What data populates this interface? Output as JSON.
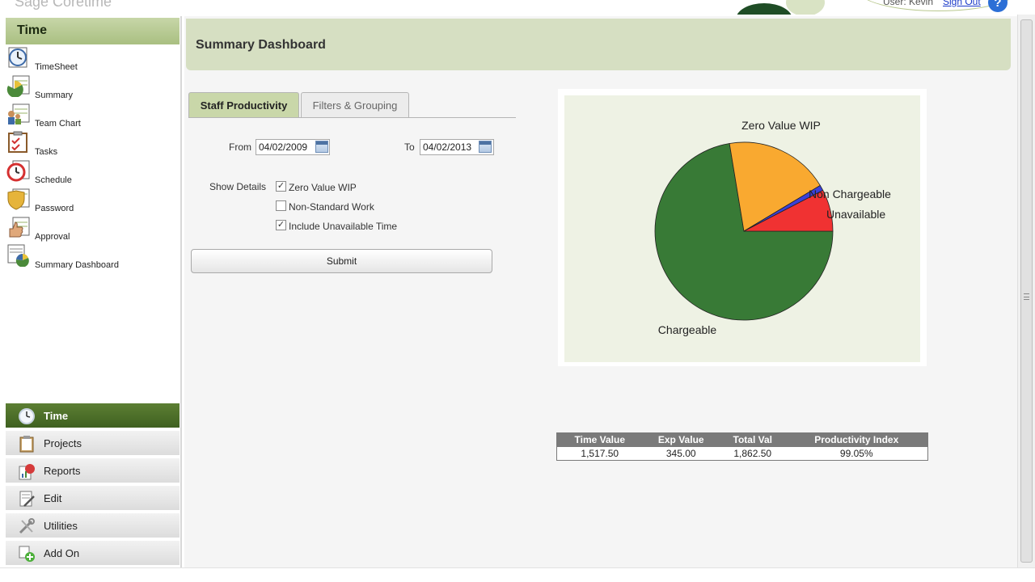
{
  "app": {
    "title": "Sage Coretime",
    "user_label": "User: Kevin",
    "sign_out": "Sign Out",
    "help": "?"
  },
  "sidebar": {
    "header": "Time",
    "items": [
      {
        "label": "TimeSheet",
        "icon": "timesheet-icon"
      },
      {
        "label": "Summary",
        "icon": "summary-icon"
      },
      {
        "label": "Team Chart",
        "icon": "team-chart-icon"
      },
      {
        "label": "Tasks",
        "icon": "tasks-icon"
      },
      {
        "label": "Schedule",
        "icon": "schedule-icon"
      },
      {
        "label": "Password",
        "icon": "password-icon"
      },
      {
        "label": "Approval",
        "icon": "approval-icon"
      },
      {
        "label": "Summary Dashboard",
        "icon": "summary-dashboard-icon"
      }
    ],
    "nav": [
      {
        "label": "Time",
        "active": true,
        "icon": "clock-icon"
      },
      {
        "label": "Projects",
        "icon": "clipboard-icon"
      },
      {
        "label": "Reports",
        "icon": "reports-icon"
      },
      {
        "label": "Edit",
        "icon": "edit-icon"
      },
      {
        "label": "Utilities",
        "icon": "utilities-icon"
      },
      {
        "label": "Add On",
        "icon": "add-on-icon"
      }
    ]
  },
  "main": {
    "title": "Summary Dashboard",
    "tabs": [
      {
        "label": "Staff Productivity",
        "active": true
      },
      {
        "label": "Filters & Grouping",
        "active": false
      }
    ],
    "from_label": "From",
    "from_value": "04/02/2009",
    "to_label": "To",
    "to_value": "04/02/2013",
    "show_details_label": "Show Details",
    "options": [
      {
        "label": "Zero Value WIP",
        "checked": true
      },
      {
        "label": "Non-Standard Work",
        "checked": false
      },
      {
        "label": "Include Unavailable Time",
        "checked": true
      }
    ],
    "submit_label": "Submit"
  },
  "chart_data": {
    "type": "pie",
    "slices": [
      {
        "label": "Chargeable",
        "value": 0.724,
        "color": "#387a36"
      },
      {
        "label": "Zero Value WIP",
        "value": 0.19,
        "color": "#f9a930"
      },
      {
        "label": "Non Chargeable",
        "value": 0.01,
        "color": "#3a40d8"
      },
      {
        "label": "Unavailable",
        "value": 0.076,
        "color": "#f03232"
      }
    ],
    "legend": "none"
  },
  "summary_table": {
    "headers": [
      "Time Value",
      "Exp Value",
      "Total Val",
      "Productivity Index"
    ],
    "rows": [
      [
        "1,517.50",
        "345.00",
        "1,862.50",
        "99.05%"
      ]
    ]
  }
}
